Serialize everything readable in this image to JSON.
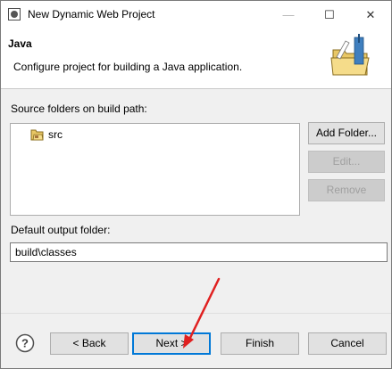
{
  "window": {
    "title": "New Dynamic Web Project",
    "minimize_glyph": "—",
    "maximize_glyph": "☐",
    "close_glyph": "✕"
  },
  "header": {
    "title": "Java",
    "description": "Configure project for building a Java application.",
    "icon": "java-folder-wizard-icon"
  },
  "source": {
    "label": "Source folders on build path:",
    "items": [
      {
        "label": "src",
        "icon": "source-folder-icon"
      }
    ],
    "buttons": {
      "add": "Add Folder...",
      "edit": "Edit...",
      "remove": "Remove"
    }
  },
  "output": {
    "label": "Default output folder:",
    "value": "build\\classes"
  },
  "footer": {
    "help_icon": "help-icon",
    "back": "< Back",
    "next": "Next >",
    "finish": "Finish",
    "cancel": "Cancel"
  },
  "annotation": {
    "arrow_color": "#e02020"
  },
  "colors": {
    "focus_border": "#0078d7",
    "disabled_text": "#a0a0a0"
  }
}
